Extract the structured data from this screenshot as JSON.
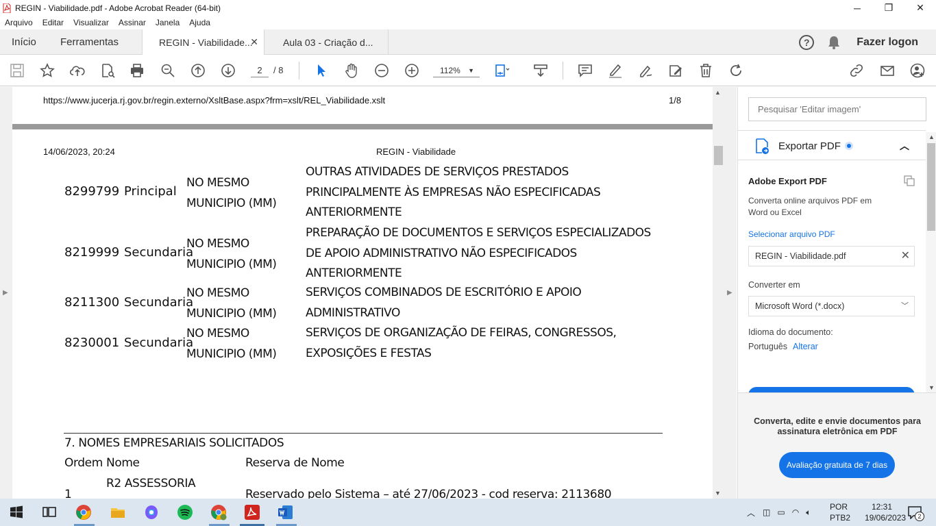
{
  "window": {
    "title": "REGIN - Viabilidade.pdf - Adobe Acrobat Reader (64-bit)"
  },
  "menu": [
    "Arquivo",
    "Editar",
    "Visualizar",
    "Assinar",
    "Janela",
    "Ajuda"
  ],
  "tabs": {
    "home": "Início",
    "tools": "Ferramentas",
    "active_doc": "REGIN - Viabilidade...",
    "second_doc": "Aula 03 - Criação d...",
    "login": "Fazer logon"
  },
  "toolbar": {
    "current_page": "2",
    "page_total": "/ 8",
    "zoom": "112%"
  },
  "page": {
    "url": "https://www.jucerja.rj.gov.br/regin.externo/XsltBase.aspx?frm=xslt/REL_Viabilidade.xslt",
    "page_num": "1/8",
    "date": "14/06/2023, 20:24",
    "header_title": "REGIN - Viabilidade",
    "activities": [
      {
        "code": "8299799",
        "kind": "Principal",
        "scope": [
          "NO MESMO",
          "MUNICIPIO (MM)"
        ],
        "desc": [
          "OUTRAS ATIVIDADES DE SERVIÇOS PRESTADOS",
          "PRINCIPALMENTE ÀS EMPRESAS NÃO ESPECIFICADAS",
          "ANTERIORMENTE"
        ]
      },
      {
        "code": "8219999",
        "kind": "Secundaria",
        "scope": [
          "NO MESMO",
          "MUNICIPIO (MM)"
        ],
        "desc": [
          "PREPARAÇÃO DE DOCUMENTOS E SERVIÇOS ESPECIALIZADOS",
          "DE APOIO ADMINISTRATIVO NÃO ESPECIFICADOS",
          "ANTERIORMENTE"
        ]
      },
      {
        "code": "8211300",
        "kind": "Secundaria",
        "scope": [
          "NO MESMO",
          "MUNICIPIO (MM)"
        ],
        "desc": [
          "SERVIÇOS COMBINADOS DE ESCRITÓRIO E APOIO",
          "ADMINISTRATIVO"
        ]
      },
      {
        "code": "8230001",
        "kind": "Secundaria",
        "scope": [
          "NO MESMO",
          "MUNICIPIO (MM)"
        ],
        "desc": [
          "SERVIÇOS DE ORGANIZAÇÃO DE FEIRAS, CONGRESSOS,",
          "EXPOSIÇÕES E FESTAS"
        ]
      }
    ],
    "section_title": "7. NOMES EMPRESARIAIS SOLICITADOS",
    "names_headers": [
      "Ordem",
      "Nome",
      "Reserva de Nome"
    ],
    "names_rows": [
      {
        "ordem": "1",
        "nome": "R2 ASSESSORIA",
        "reserva": "Reservado pelo Sistema – até 27/06/2023 - cod reserva: 2113680"
      }
    ]
  },
  "panel": {
    "search_placeholder": "Pesquisar 'Editar imagem'",
    "export_title": "Exportar PDF",
    "heading": "Adobe Export PDF",
    "description": "Converta online arquivos PDF em Word ou Excel",
    "select_link": "Selecionar arquivo PDF",
    "file_name": "REGIN - Viabilidade.pdf",
    "convert_label": "Converter em",
    "convert_value": "Microsoft Word (*.docx)",
    "lang_label": "Idioma do documento:",
    "lang_value": "Português",
    "lang_change": "Alterar",
    "promo": "Converta, edite e envie documentos para assinatura eletrônica em PDF",
    "trial_button": "Avaliação gratuita de 7 dias"
  },
  "taskbar": {
    "lang_line1": "POR",
    "lang_line2": "PTB2",
    "time": "12:31",
    "date": "19/06/2023",
    "notifications": "2"
  },
  "colors": {
    "accent": "#1473e6",
    "acrobat_red": "#d0241f",
    "taskbar": "#dbe6f0"
  }
}
